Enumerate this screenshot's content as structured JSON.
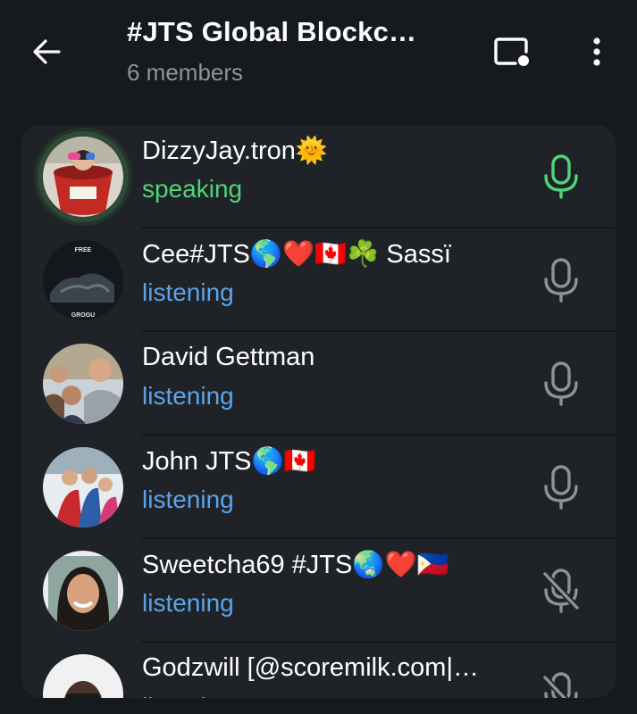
{
  "header": {
    "title": "#JTS Global Blockc…",
    "subtitle": "6 members"
  },
  "participants": [
    {
      "name": "DizzyJay.tron🌞",
      "status": "speaking",
      "mic": "active"
    },
    {
      "name": "Cee#JTS🌎❤️🇨🇦☘️ Sassï",
      "status": "listening",
      "mic": "on"
    },
    {
      "name": "David Gettman",
      "status": "listening",
      "mic": "on"
    },
    {
      "name": "John JTS🌎🇨🇦",
      "status": "listening",
      "mic": "on"
    },
    {
      "name": "Sweetcha69 #JTS🌏❤️🇵🇭",
      "status": "listening",
      "mic": "muted"
    },
    {
      "name": "Godzwill [@scoremilk.com|…",
      "status": "listening",
      "mic": "muted"
    }
  ],
  "avatar_texts": {
    "free": "FREE",
    "grogu": "GROGU"
  },
  "colors": {
    "background": "#16191d",
    "panel": "#1f2328",
    "speaking": "#4fd47a",
    "listening": "#5ba4ea",
    "mic_idle": "#8b9298"
  }
}
